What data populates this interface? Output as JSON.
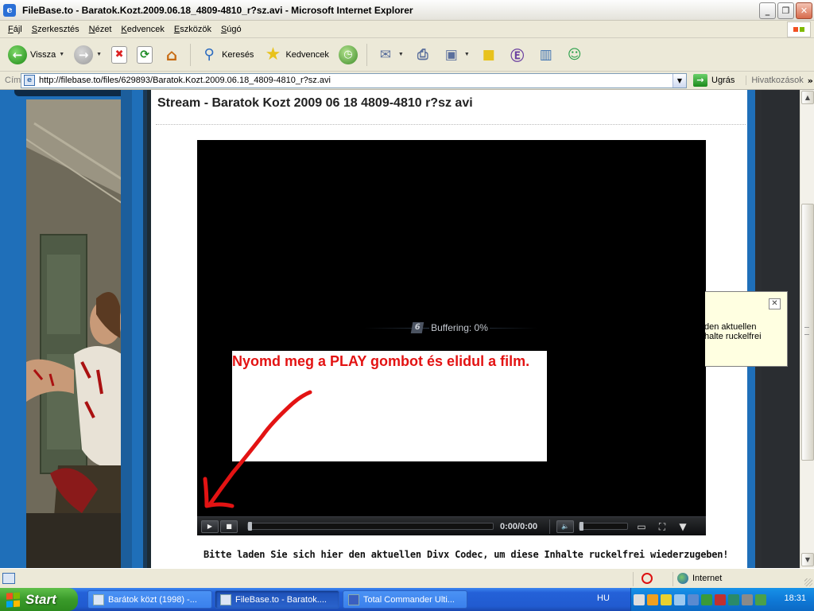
{
  "window": {
    "title": "FileBase.to - Baratok.Kozt.2009.06.18_4809-4810_r?sz.avi - Microsoft Internet Explorer",
    "minimize": "_",
    "maximize": "❐",
    "close": "✕"
  },
  "menu": [
    "Fájl",
    "Szerkesztés",
    "Nézet",
    "Kedvencek",
    "Eszközök",
    "Súgó"
  ],
  "toolbar": {
    "back": "Vissza",
    "search": "Keresés",
    "favorites": "Kedvencek"
  },
  "address": {
    "label": "Cím",
    "url": "http://filebase.to/files/629893/Baratok.Kozt.2009.06.18_4809-4810_r?sz.avi",
    "go": "Ugrás",
    "links": "Hivatkozások"
  },
  "page": {
    "stream_title": "Stream - Baratok Kozt 2009 06 18 4809-4810 r?sz avi",
    "buffering": "Buffering: 0%",
    "overlay_text": "Nyomd meg a PLAY gombot és elidul a film.",
    "time": "0:00/0:00",
    "codec_message": "Bitte laden Sie sich hier den aktuellen Divx Codec, um diese Inhalte ruckelfrei wiederzugeben!",
    "tooltip_line1": "den aktuellen",
    "tooltip_line2": "halte ruckelfrei"
  },
  "status": {
    "zone": "Internet"
  },
  "taskbar": {
    "start": "Start",
    "tasks": [
      {
        "label": "Barátok közt (1998) -..."
      },
      {
        "label": "FileBase.to - Baratok...."
      },
      {
        "label": "Total Commander Ulti..."
      }
    ],
    "language": "HU",
    "clock": "18:31"
  },
  "colors": {
    "overlay_text": "#e31313",
    "arrow": "#e31313",
    "xp_blue": "#215bd0",
    "start_green": "#3a9a2a"
  },
  "icons": [
    "ie-icon",
    "back-icon",
    "forward-icon",
    "stop-icon",
    "refresh-icon",
    "home-icon",
    "search-icon",
    "favorites-icon",
    "history-icon",
    "mail-icon",
    "print-icon",
    "edit-icon",
    "notes-icon",
    "messenger-icon",
    "go-icon",
    "globe-icon"
  ]
}
